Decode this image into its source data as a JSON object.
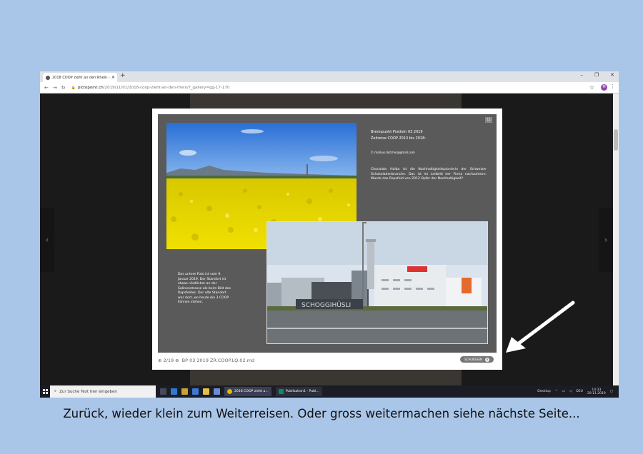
{
  "browser": {
    "tab_title": "2018 COOP zieht an den Rhein - ...",
    "url_domain": "pictopoint.ch",
    "url_path": "/2019/11/01/2018-coop-zieht-an-den-rhein/?_gallery=gg-17-170",
    "avatar_letter": "M"
  },
  "lightbox": {
    "slide_number": "11",
    "text_title": "Brennpunkt Pratteln 03 2019",
    "text_subtitle": "Zeitreise COOP 2013 bis 2018:",
    "text_email": "© markus.dutcher@gmail.com",
    "text_body": "Chocolats Halba ist die Nachhaltigkeitspionierin der Schweizer Schokoladenbranche. Das ist im Leitbild der Firma nachzulesen. Wurde das Rapsfeld von 2012 Opfer der Nachhaltigkeit?",
    "text_note": "Das untere Foto ist vom 9. Januar 2019. Der Standort ist etwas nördlicher an der Salinenstrasse als beim Bild des Rapsfeldes. Der alte Standort war dort, wo heute die 3 COOP Fahnen stehen.",
    "building_sign": "SCHOGGIHÜSLI",
    "counter": "⊕ 2/19 ⊕",
    "caption": "BP 03 2019 ZR.COOP.LQ.02.md",
    "close_label": "SCHLIESSEN"
  },
  "taskbar": {
    "search_placeholder": "Zur Suche Text hier eingeben",
    "app1": "2018 COOP zieht a...",
    "app2": "Publikation1 - Publ...",
    "desktop_label": "Desktop",
    "lang": "DEU",
    "time": "14:33",
    "date": "29.11.2019"
  },
  "slide_caption": "Zurück, wieder klein zum Weiterreisen. Oder gross weitermachen siehe nächste Seite...",
  "colors": {
    "background": "#a9c6e8",
    "slide_bg": "#5a5a5a",
    "taskbar": "#1c1c24",
    "rapeseed": "#e8d400",
    "sky": "#3a78d8"
  }
}
